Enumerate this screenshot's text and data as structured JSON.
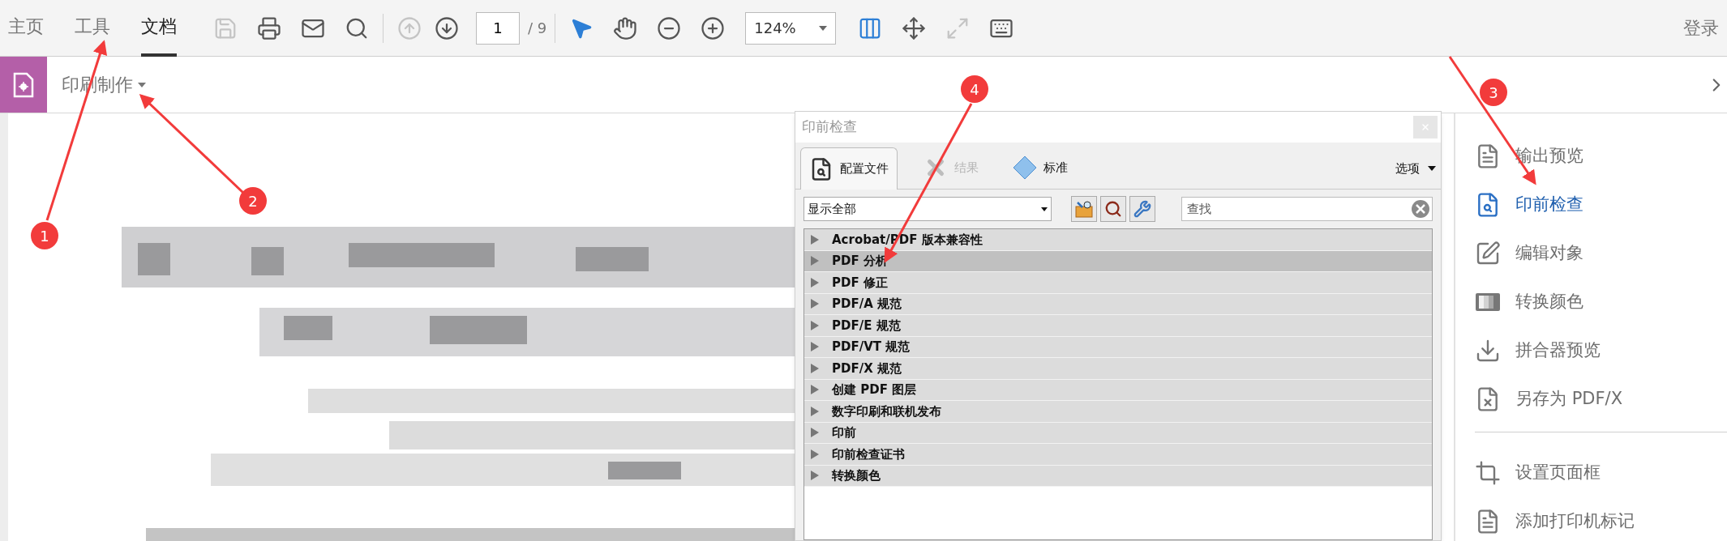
{
  "top_bar": {
    "tabs": [
      {
        "label": "主页",
        "selected": false
      },
      {
        "label": "工具",
        "selected": false
      },
      {
        "label": "文档",
        "selected": true
      }
    ],
    "file_tools": [
      {
        "kind": "save",
        "disabled": true,
        "selected": false
      },
      {
        "kind": "print",
        "disabled": false,
        "selected": false
      },
      {
        "kind": "mail",
        "disabled": false,
        "selected": false
      },
      {
        "kind": "search",
        "disabled": false,
        "selected": false
      }
    ],
    "page_tools": [
      {
        "kind": "page-up",
        "disabled": true,
        "selected": false
      },
      {
        "kind": "page-down",
        "disabled": false,
        "selected": false
      }
    ],
    "page_field": {
      "value": "1"
    },
    "page_total": "/ 9",
    "view_tools": [
      {
        "kind": "select",
        "disabled": false,
        "selected": true
      },
      {
        "kind": "hand",
        "disabled": false,
        "selected": false
      },
      {
        "kind": "zoom-out",
        "disabled": false,
        "selected": false
      },
      {
        "kind": "zoom-in",
        "disabled": false,
        "selected": false
      }
    ],
    "zoom_field": {
      "value": "124%"
    },
    "extra_tools": [
      {
        "kind": "fit-width",
        "disabled": false,
        "selected": true
      },
      {
        "kind": "page-move",
        "disabled": false,
        "selected": false
      },
      {
        "kind": "fullscreen",
        "disabled": true,
        "selected": false
      },
      {
        "kind": "reader",
        "disabled": false,
        "selected": false
      }
    ],
    "login": "登录"
  },
  "tool_bar": {
    "title": "印刷制作"
  },
  "preflight_dialog": {
    "title": "印前检查",
    "tabs": [
      {
        "kind": "profiles",
        "label": "配置文件",
        "selected": true,
        "disabled": false
      },
      {
        "kind": "results",
        "label": "结果",
        "selected": false,
        "disabled": true
      },
      {
        "kind": "standards",
        "label": "标准",
        "selected": false,
        "disabled": false
      }
    ],
    "options": "选项",
    "filter": {
      "value": "显示全部"
    },
    "search": {
      "placeholder": "查找"
    },
    "categories": [
      {
        "label": "Acrobat/PDF 版本兼容性",
        "selected": false
      },
      {
        "label": "PDF 分析",
        "selected": true
      },
      {
        "label": "PDF 修正",
        "selected": false
      },
      {
        "label": "PDF/A 规范",
        "selected": false
      },
      {
        "label": "PDF/E 规范",
        "selected": false
      },
      {
        "label": "PDF/VT 规范",
        "selected": false
      },
      {
        "label": "PDF/X 规范",
        "selected": false
      },
      {
        "label": "创建 PDF 图层",
        "selected": false
      },
      {
        "label": "数字印刷和联机发布",
        "selected": false
      },
      {
        "label": "印前",
        "selected": false
      },
      {
        "label": "印前检查证书",
        "selected": false
      },
      {
        "label": "转换颜色",
        "selected": false
      }
    ]
  },
  "right_panel": {
    "sections": [
      {
        "items": [
          {
            "kind": "output-preview",
            "label": "输出预览",
            "selected": false
          },
          {
            "kind": "preflight",
            "label": "印前检查",
            "selected": true
          },
          {
            "kind": "edit-object",
            "label": "编辑对象",
            "selected": false
          },
          {
            "kind": "convert-colors",
            "label": "转换颜色",
            "selected": false
          },
          {
            "kind": "flattener",
            "label": "拼合器预览",
            "selected": false
          },
          {
            "kind": "save-pdfx",
            "label": "另存为 PDF/X",
            "selected": false
          }
        ]
      },
      {
        "items": [
          {
            "kind": "page-boxes",
            "label": "设置页面框",
            "selected": false
          },
          {
            "kind": "printer-marks",
            "label": "添加打印机标记",
            "selected": false
          }
        ]
      }
    ]
  },
  "annotations": [
    {
      "label": "1"
    },
    {
      "label": "2"
    },
    {
      "label": "3"
    },
    {
      "label": "4"
    }
  ]
}
